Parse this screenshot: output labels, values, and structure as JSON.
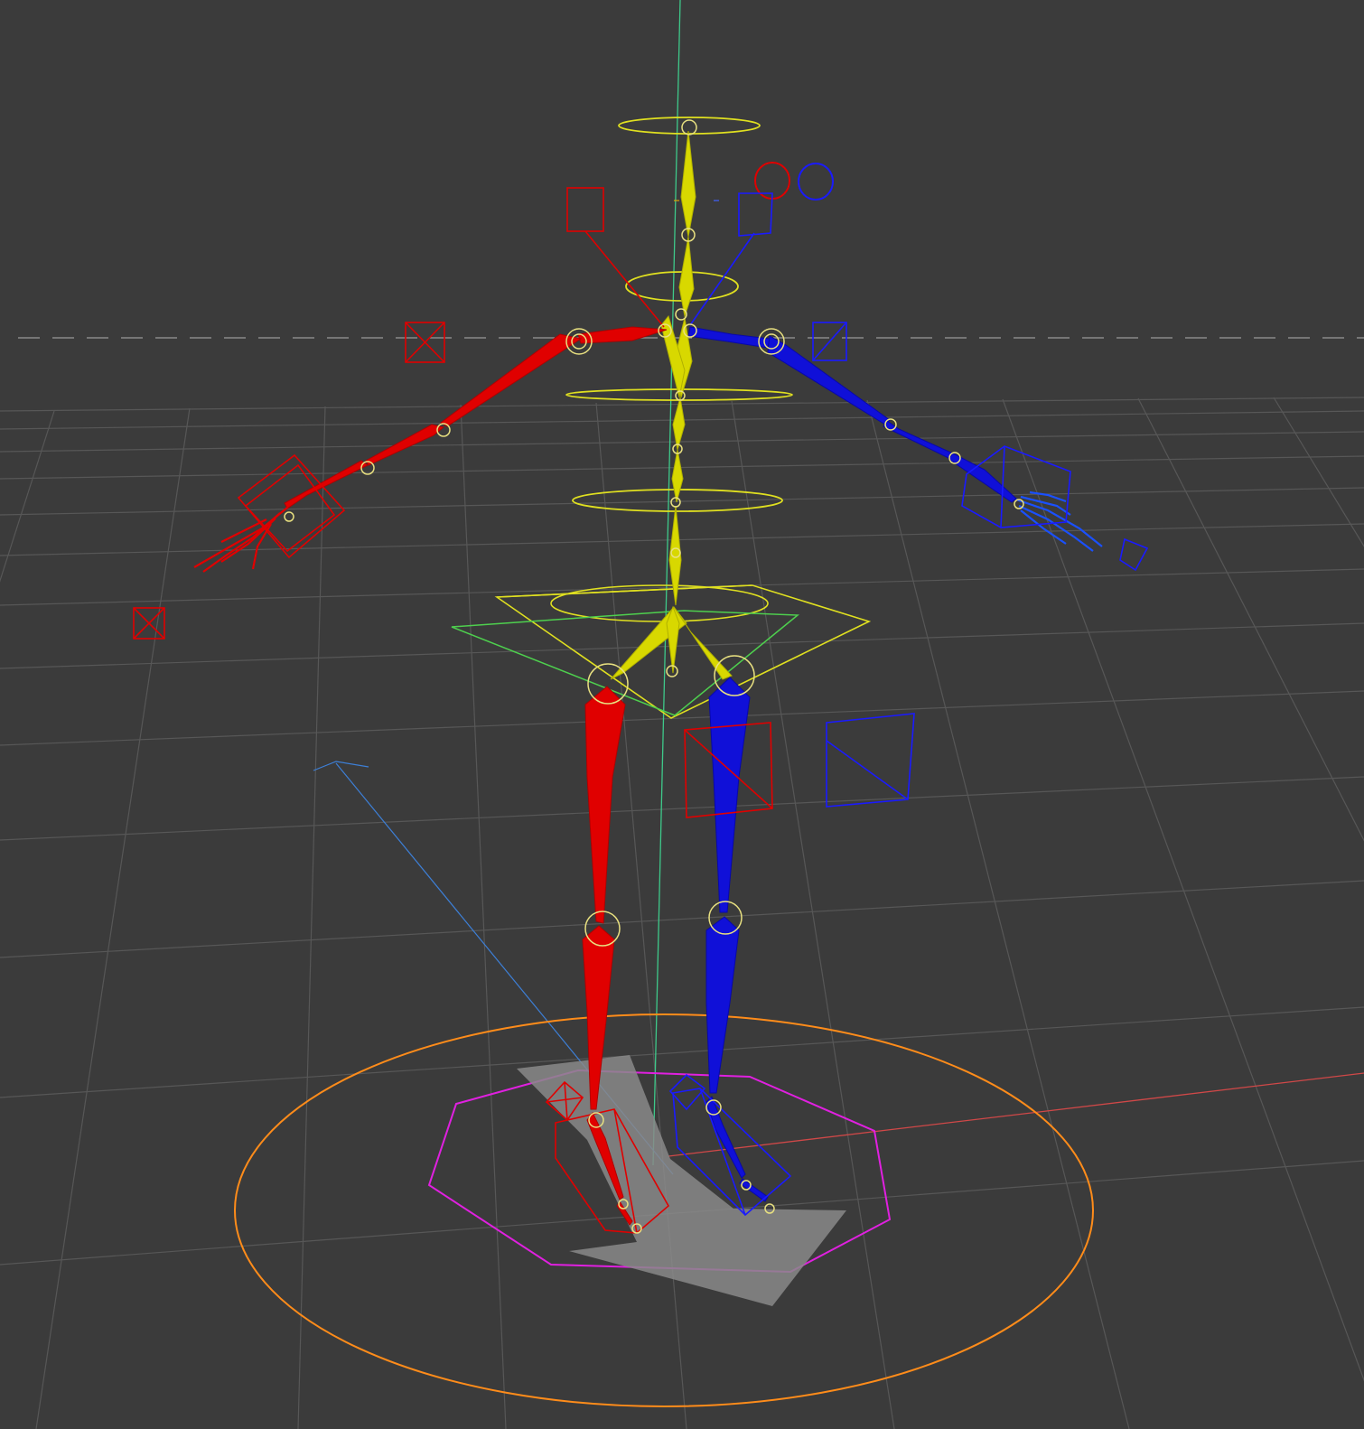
{
  "viewport": {
    "kind": "3d-rig-viewport",
    "background": "#3b3b3b",
    "grid_color": "#555555",
    "horizon_dash_color": "#8a8a8a"
  },
  "colors": {
    "spine": "#d8d800",
    "left_side": "#e00000",
    "right_side": "#1010d8",
    "root_circle": "#ff8c1a",
    "cog_octagon": "#e020e0",
    "hips_control": "#e0e020",
    "axis_y": "#3ec98a",
    "axis_x": "#d04848",
    "axis_z": "#3d7fd6",
    "joint_marker": "#e8e080",
    "foot_shadow": "#8a8a8a"
  },
  "rig": {
    "bone_groups": [
      "spine",
      "left-arm",
      "right-arm",
      "left-leg",
      "right-leg"
    ],
    "controls": [
      "root-circle",
      "cog-octagon",
      "hips-control",
      "ik-box",
      "fk-circle",
      "pole-vector"
    ]
  }
}
